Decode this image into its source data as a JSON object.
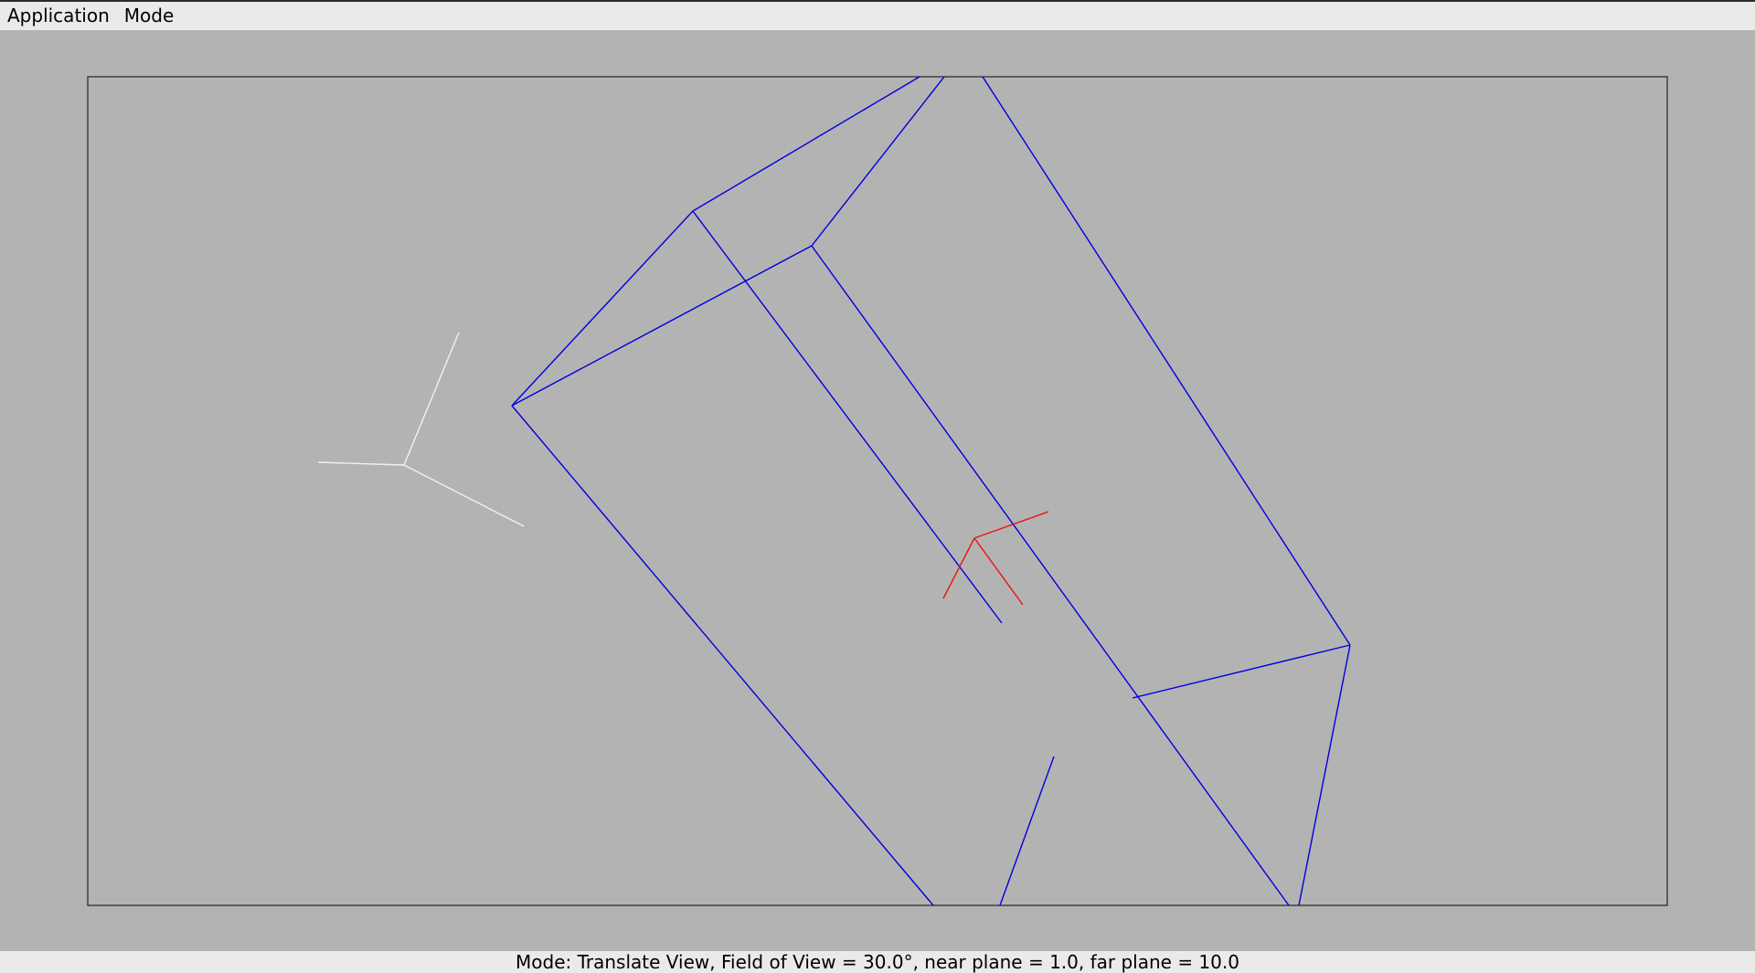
{
  "menubar": {
    "items": [
      {
        "label": "Application"
      },
      {
        "label": "Mode"
      }
    ]
  },
  "statusbar": {
    "text": "Mode: Translate View, Field of View = 30.0°, near plane = 1.0, far plane = 10.0"
  },
  "colors": {
    "background": "#b3b3b3",
    "frustum": "#0000dd",
    "object_axes": "#ee1111",
    "world_axes": "#f2f2f2",
    "viewport_border": "#222222"
  }
}
